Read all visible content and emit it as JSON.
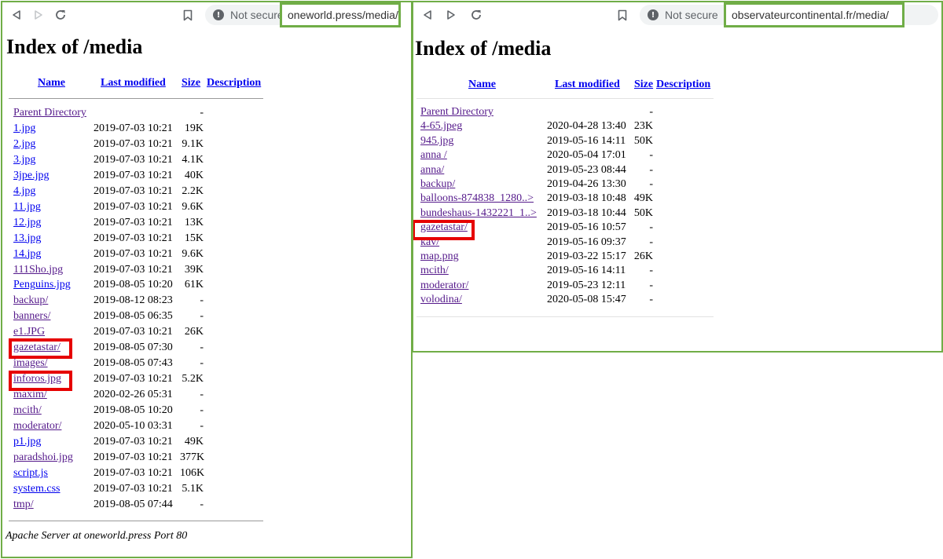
{
  "left": {
    "browser": {
      "security_label": "Not secure",
      "url": "oneworld.press/media/"
    },
    "title": "Index of /media",
    "columns": {
      "name": "Name",
      "modified": "Last modified",
      "size": "Size",
      "description": "Description"
    },
    "rows": [
      {
        "name": "Parent Directory",
        "date": "",
        "size": "-"
      },
      {
        "name": "1.jpg",
        "date": "2019-07-03 10:21",
        "size": "19K"
      },
      {
        "name": "2.jpg",
        "date": "2019-07-03 10:21",
        "size": "9.1K"
      },
      {
        "name": "3.jpg",
        "date": "2019-07-03 10:21",
        "size": "4.1K"
      },
      {
        "name": "3jpe.jpg",
        "date": "2019-07-03 10:21",
        "size": "40K"
      },
      {
        "name": "4.jpg",
        "date": "2019-07-03 10:21",
        "size": "2.2K"
      },
      {
        "name": "11.jpg",
        "date": "2019-07-03 10:21",
        "size": "9.6K"
      },
      {
        "name": "12.jpg",
        "date": "2019-07-03 10:21",
        "size": "13K"
      },
      {
        "name": "13.jpg",
        "date": "2019-07-03 10:21",
        "size": "15K"
      },
      {
        "name": "14.jpg",
        "date": "2019-07-03 10:21",
        "size": "9.6K"
      },
      {
        "name": "111Sho.jpg",
        "date": "2019-07-03 10:21",
        "size": "39K"
      },
      {
        "name": "Penguins.jpg",
        "date": "2019-08-05 10:20",
        "size": "61K"
      },
      {
        "name": "backup/",
        "date": "2019-08-12 08:23",
        "size": "-"
      },
      {
        "name": "banners/",
        "date": "2019-08-05 06:35",
        "size": "-"
      },
      {
        "name": "e1.JPG",
        "date": "2019-07-03 10:21",
        "size": "26K"
      },
      {
        "name": "gazetastar/",
        "date": "2019-08-05 07:30",
        "size": "-"
      },
      {
        "name": "images/",
        "date": "2019-08-05 07:43",
        "size": "-"
      },
      {
        "name": "inforos.jpg",
        "date": "2019-07-03 10:21",
        "size": "5.2K"
      },
      {
        "name": "maxim/",
        "date": "2020-02-26 05:31",
        "size": "-"
      },
      {
        "name": "mcith/",
        "date": "2019-08-05 10:20",
        "size": "-"
      },
      {
        "name": "moderator/",
        "date": "2020-05-10 03:31",
        "size": "-"
      },
      {
        "name": "p1.jpg",
        "date": "2019-07-03 10:21",
        "size": "49K"
      },
      {
        "name": "paradshoi.jpg",
        "date": "2019-07-03 10:21",
        "size": "377K"
      },
      {
        "name": "script.js",
        "date": "2019-07-03 10:21",
        "size": "106K"
      },
      {
        "name": "system.css",
        "date": "2019-07-03 10:21",
        "size": "5.1K"
      },
      {
        "name": "tmp/",
        "date": "2019-08-05 07:44",
        "size": "-"
      }
    ],
    "footer": "Apache Server at oneworld.press Port 80"
  },
  "right": {
    "browser": {
      "security_label": "Not secure",
      "url": "observateurcontinental.fr/media/"
    },
    "title": "Index of /media",
    "columns": {
      "name": "Name",
      "modified": "Last modified",
      "size": "Size",
      "description": "Description"
    },
    "rows": [
      {
        "name": "Parent Directory",
        "date": "",
        "size": "-"
      },
      {
        "name": "4-65.jpeg",
        "date": "2020-04-28 13:40",
        "size": "23K"
      },
      {
        "name": "945.jpg",
        "date": "2019-05-16 14:11",
        "size": "50K"
      },
      {
        "name": "anna /",
        "date": "2020-05-04 17:01",
        "size": "-"
      },
      {
        "name": "anna/",
        "date": "2019-05-23 08:44",
        "size": "-"
      },
      {
        "name": "backup/",
        "date": "2019-04-26 13:30",
        "size": "-"
      },
      {
        "name": "balloons-874838_1280..>",
        "date": "2019-03-18 10:48",
        "size": "49K"
      },
      {
        "name": "bundeshaus-1432221_1..>",
        "date": "2019-03-18 10:44",
        "size": "50K"
      },
      {
        "name": "gazetastar/",
        "date": "2019-05-16 10:57",
        "size": "-"
      },
      {
        "name": "kav/",
        "date": "2019-05-16 09:37",
        "size": "-"
      },
      {
        "name": "map.png",
        "date": "2019-03-22 15:17",
        "size": "26K"
      },
      {
        "name": "mcith/",
        "date": "2019-05-16 14:11",
        "size": "-"
      },
      {
        "name": "moderator/",
        "date": "2019-05-23 12:11",
        "size": "-"
      },
      {
        "name": "volodina/",
        "date": "2020-05-08 15:47",
        "size": "-"
      }
    ]
  },
  "colors": {
    "frame_green": "#70ad47",
    "highlight_red": "#e60000",
    "link_blue": "#0000ee",
    "link_visited": "#551a8b"
  },
  "icons": [
    "back-icon",
    "forward-icon",
    "reload-icon",
    "bookmark-icon",
    "info-icon"
  ]
}
